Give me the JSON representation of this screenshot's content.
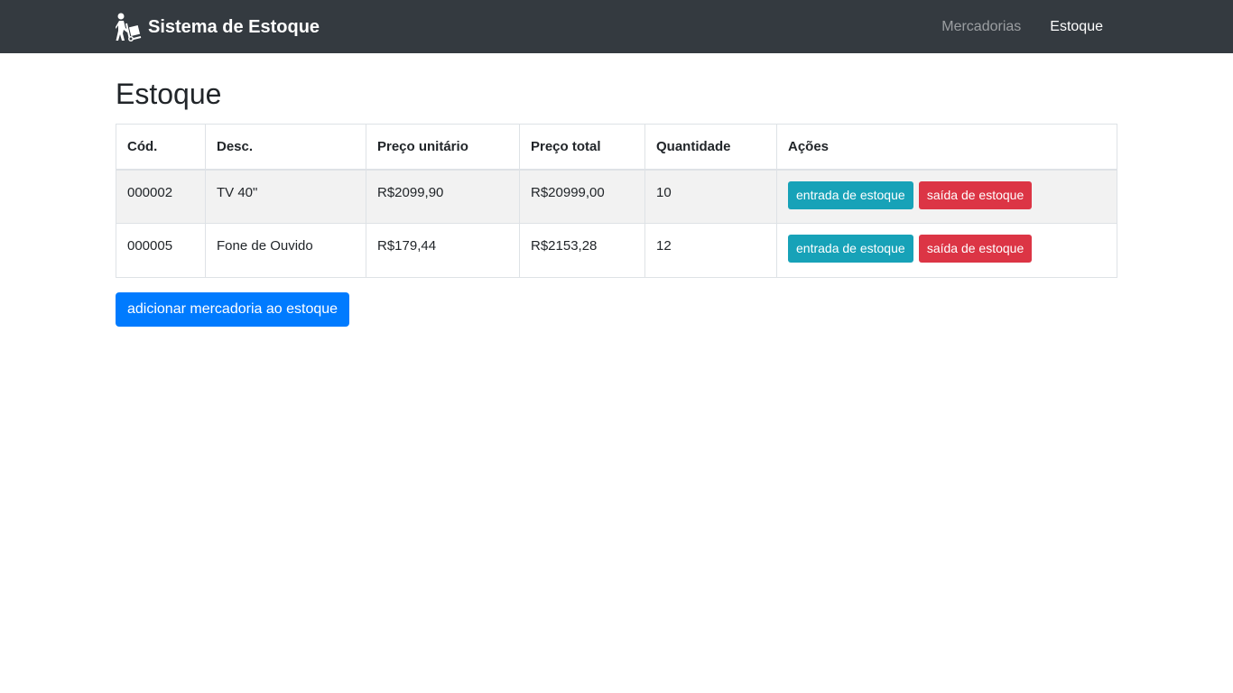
{
  "navbar": {
    "brand": "Sistema de Estoque",
    "brand_icon": "hand-truck-icon",
    "links": [
      {
        "label": "Mercadorias",
        "active": false
      },
      {
        "label": "Estoque",
        "active": true
      }
    ]
  },
  "page": {
    "title": "Estoque"
  },
  "table": {
    "headers": [
      "Cód.",
      "Desc.",
      "Preço unitário",
      "Preço total",
      "Quantidade",
      "Ações"
    ],
    "rows": [
      {
        "code": "000002",
        "desc": "TV 40\"",
        "unit_price": "R$2099,90",
        "total_price": "R$20999,00",
        "quantity": "10",
        "entry_label": "entrada de estoque",
        "exit_label": "saída de estoque"
      },
      {
        "code": "000005",
        "desc": "Fone de Ouvido",
        "unit_price": "R$179,44",
        "total_price": "R$2153,28",
        "quantity": "12",
        "entry_label": "entrada de estoque",
        "exit_label": "saída de estoque"
      }
    ]
  },
  "add_button_label": "adicionar mercadoria ao estoque",
  "colors": {
    "navbar_bg": "#343a40",
    "info": "#17a2b8",
    "danger": "#dc3545",
    "primary": "#007bff",
    "stripe": "#f2f2f2"
  }
}
